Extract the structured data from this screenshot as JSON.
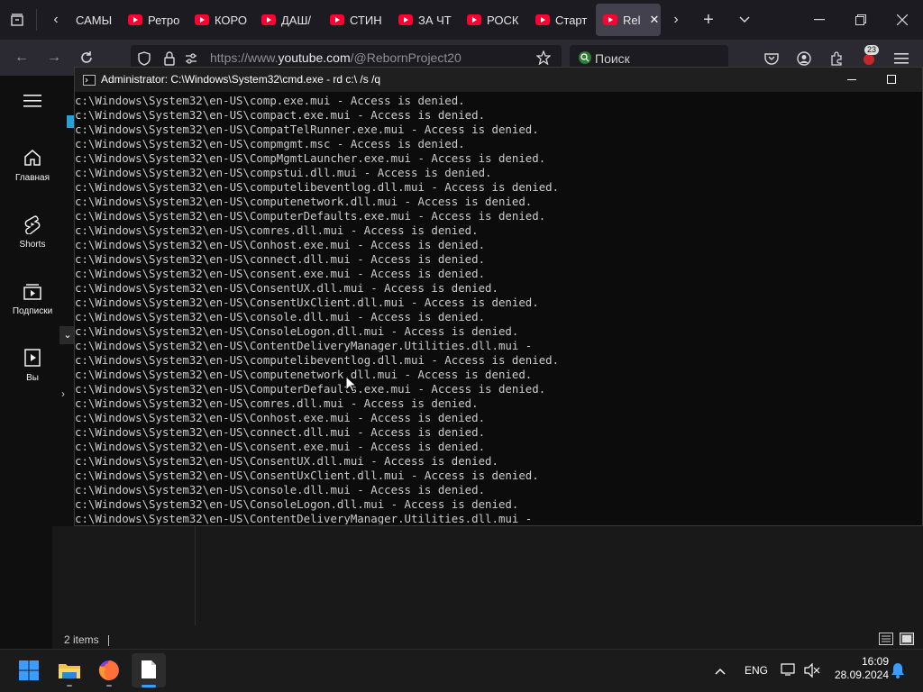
{
  "browser": {
    "tabs": [
      {
        "label": "САМЫ"
      },
      {
        "label": "Ретро"
      },
      {
        "label": "КОРО"
      },
      {
        "label": "ДАШ/"
      },
      {
        "label": "СТИН"
      },
      {
        "label": "ЗА ЧТ"
      },
      {
        "label": "РОСК"
      },
      {
        "label": "Старт"
      },
      {
        "label": "Rel"
      }
    ],
    "url_prefix": "https://www.",
    "url_domain": "youtube.com",
    "url_path": "/@RebornProject20",
    "search_placeholder": "Поиск",
    "extension_badge": "23"
  },
  "youtube_sidebar": {
    "items": [
      {
        "label": "Главная",
        "icon": "home-icon"
      },
      {
        "label": "Shorts",
        "icon": "shorts-icon"
      },
      {
        "label": "Подписки",
        "icon": "subscriptions-icon"
      },
      {
        "label": "Вы",
        "icon": "you-icon"
      }
    ]
  },
  "cmd": {
    "title": "Administrator: C:\\Windows\\System32\\cmd.exe - rd  c:\\ /s /q",
    "lines": [
      "c:\\Windows\\System32\\en-US\\comp.exe.mui - Access is denied.",
      "c:\\Windows\\System32\\en-US\\compact.exe.mui - Access is denied.",
      "c:\\Windows\\System32\\en-US\\CompatTelRunner.exe.mui - Access is denied.",
      "c:\\Windows\\System32\\en-US\\compmgmt.msc - Access is denied.",
      "c:\\Windows\\System32\\en-US\\CompMgmtLauncher.exe.mui - Access is denied.",
      "c:\\Windows\\System32\\en-US\\compstui.dll.mui - Access is denied.",
      "c:\\Windows\\System32\\en-US\\computelibeventlog.dll.mui - Access is denied.",
      "c:\\Windows\\System32\\en-US\\computenetwork.dll.mui - Access is denied.",
      "c:\\Windows\\System32\\en-US\\ComputerDefaults.exe.mui - Access is denied.",
      "c:\\Windows\\System32\\en-US\\comres.dll.mui - Access is denied.",
      "c:\\Windows\\System32\\en-US\\Conhost.exe.mui - Access is denied.",
      "c:\\Windows\\System32\\en-US\\connect.dll.mui - Access is denied.",
      "c:\\Windows\\System32\\en-US\\consent.exe.mui - Access is denied.",
      "c:\\Windows\\System32\\en-US\\ConsentUX.dll.mui - Access is denied.",
      "c:\\Windows\\System32\\en-US\\ConsentUxClient.dll.mui - Access is denied.",
      "c:\\Windows\\System32\\en-US\\console.dll.mui - Access is denied.",
      "c:\\Windows\\System32\\en-US\\ConsoleLogon.dll.mui - Access is denied.",
      "c:\\Windows\\System32\\en-US\\ContentDeliveryManager.Utilities.dll.mui - ",
      "c:\\Windows\\System32\\en-US\\computelibeventlog.dll.mui - Access is denied.",
      "c:\\Windows\\System32\\en-US\\computenetwork.dll.mui - Access is denied.",
      "c:\\Windows\\System32\\en-US\\ComputerDefaults.exe.mui - Access is denied.",
      "c:\\Windows\\System32\\en-US\\comres.dll.mui - Access is denied.",
      "c:\\Windows\\System32\\en-US\\Conhost.exe.mui - Access is denied.",
      "c:\\Windows\\System32\\en-US\\connect.dll.mui - Access is denied.",
      "c:\\Windows\\System32\\en-US\\consent.exe.mui - Access is denied.",
      "c:\\Windows\\System32\\en-US\\ConsentUX.dll.mui - Access is denied.",
      "c:\\Windows\\System32\\en-US\\ConsentUxClient.dll.mui - Access is denied.",
      "c:\\Windows\\System32\\en-US\\console.dll.mui - Access is denied.",
      "c:\\Windows\\System32\\en-US\\ConsoleLogon.dll.mui - Access is denied.",
      "c:\\Windows\\System32\\en-US\\ContentDeliveryManager.Utilities.dll.mui - "
    ]
  },
  "explorer": {
    "status": "2 items"
  },
  "taskbar": {
    "language": "ENG",
    "time": "16:09",
    "date": "28.09.2024"
  },
  "colors": {
    "youtube_red": "#ff0033",
    "terminal_bg": "#0c0c0c",
    "terminal_text": "#cccccc",
    "win_accent": "#3b9cff"
  }
}
